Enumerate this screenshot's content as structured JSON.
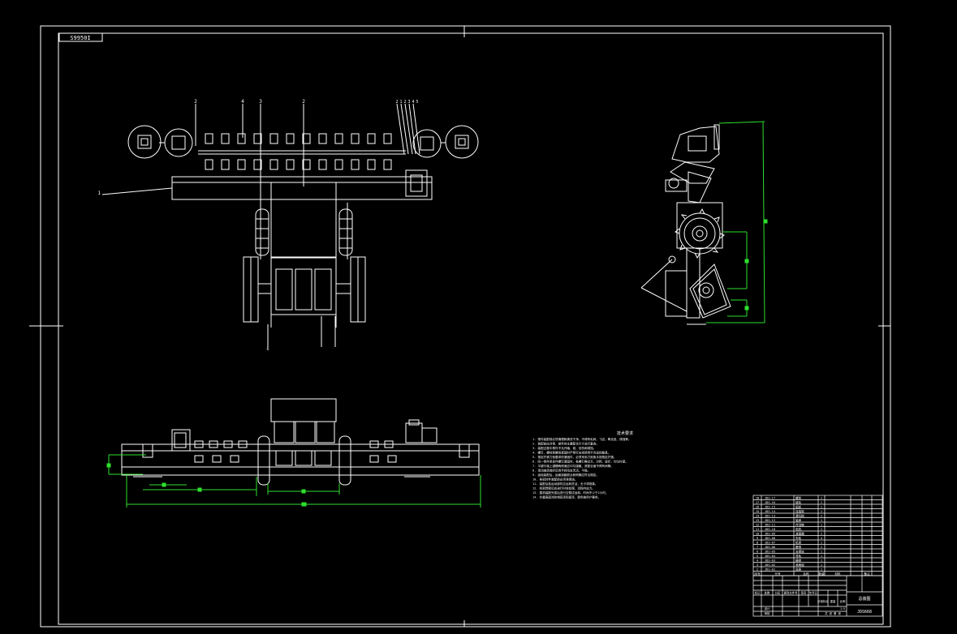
{
  "drawing": {
    "code_tag": "S9950I",
    "drawing_number": "JDS668"
  },
  "callouts": [
    "2",
    "4",
    "3",
    "2",
    "1",
    "2",
    "1",
    "2",
    "3",
    "4",
    "5",
    "6"
  ],
  "tech_requirements": {
    "title": "技术要求",
    "lines": [
      "1. 零件装配前必须清理和清洗干净，不得有毛刺、飞边、氧化皮、锈蚀等。",
      "2. 装配前应对零、部件的主要配合尺寸进行复查。",
      "3. 装配过程中零件不允许磕、碰、划伤和锈蚀。",
      "4. 螺钉、螺栓和螺母紧固时严禁打击或使用不合适的旋具。",
      "5. 规定拧紧力矩要求的紧固件，必须采用力矩扳手按规定拧紧。",
      "6. 同一零件用多件螺钉紧固时，各螺钉需交叉、对称、逐步、均匀拧紧。",
      "7. 平键与轴上键槽两侧面应均匀接触，其配合面不得有间隙。",
      "8. 滚动轴承装好后用手转动应灵活、平稳。",
      "9. 齿轮装配后，齿面接触斑点和侧隙应符合规定。",
      "10. 各密封件装配前必须浸透油。",
      "11. 装配后各运动部件应运转灵活，无卡滞现象。",
      "12. 机架焊接后应进行时效处理，消除内应力。",
      "13. 整机装配完成后进行空载试运转，时间不少于2小时。",
      "14. 外露表面涂防锈底漆和面漆，颜色按用户要求。"
    ]
  },
  "bom": {
    "rows": [
      {
        "no": "18",
        "code": "JDS-17",
        "name": "螺栓",
        "qty": "1"
      },
      {
        "no": "17",
        "code": "JDS-16",
        "name": "链轮",
        "qty": "1"
      },
      {
        "no": "16",
        "code": "JDS-15",
        "name": "齿轮",
        "qty": "1"
      },
      {
        "no": "15",
        "code": "JDS-14",
        "name": "连接架",
        "qty": "1"
      },
      {
        "no": "14",
        "code": "JDS-13",
        "name": "清扫刷",
        "qty": "2"
      },
      {
        "no": "13",
        "code": "JDS-12",
        "name": "轴承",
        "qty": "1"
      },
      {
        "no": "12",
        "code": "JDS-11",
        "name": "传动链",
        "qty": "1"
      },
      {
        "no": "11",
        "code": "JDS-10",
        "name": "电机",
        "qty": "1"
      },
      {
        "no": "10",
        "code": "JDS-09",
        "name": "减速器",
        "qty": "1"
      },
      {
        "no": "9",
        "code": "JDS-08",
        "name": "车轮",
        "qty": "4"
      },
      {
        "no": "8",
        "code": "JDS-07",
        "name": "机架",
        "qty": "1"
      },
      {
        "no": "7",
        "code": "JDS-06",
        "name": "履带",
        "qty": "2"
      },
      {
        "no": "6",
        "code": "JDS-05",
        "name": "支撑轮",
        "qty": "1"
      },
      {
        "no": "5",
        "code": "JDS-04",
        "name": "导轨",
        "qty": "1"
      },
      {
        "no": "4",
        "code": "JDS-03",
        "name": "横梁",
        "qty": "1"
      },
      {
        "no": "3",
        "code": "JDS-02",
        "name": "滚刷组",
        "qty": "1"
      },
      {
        "no": "2",
        "code": "JDS-01",
        "name": "底座",
        "qty": "1"
      }
    ],
    "header": [
      "序号",
      "代号",
      "名称",
      "数量",
      "材料",
      "备注"
    ]
  },
  "title_block": {
    "labels": [
      "标记",
      "处数",
      "分区",
      "更改文件号",
      "签名",
      "年月日"
    ],
    "scale_label": "比例",
    "scale_value": "1:5",
    "stage_label": "阶段标记",
    "weight_label": "重量",
    "drawing_name": "总装图",
    "sheet_text": "共 张 第 张",
    "designer_label": "设计",
    "reviewer_label": "审核"
  }
}
